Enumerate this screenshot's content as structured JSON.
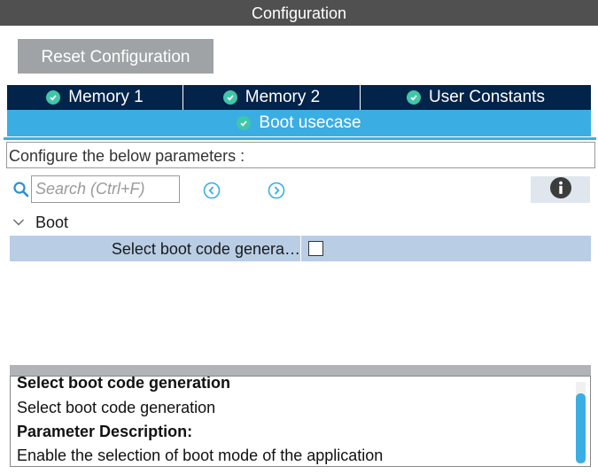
{
  "window": {
    "title": "Configuration"
  },
  "toolbar": {
    "reset_label": "Reset Configuration"
  },
  "tabs": [
    {
      "label": "Memory 1"
    },
    {
      "label": "Memory 2"
    },
    {
      "label": "User Constants"
    }
  ],
  "active_tab": {
    "label": "Boot usecase"
  },
  "params_header": "Configure the below parameters :",
  "search": {
    "placeholder": "Search (Ctrl+F)"
  },
  "tree": {
    "group_label": "Boot",
    "params": [
      {
        "name": "Select boot code genera…",
        "checked": false
      }
    ]
  },
  "description": {
    "cut_title": "Select boot code generation",
    "subtitle": "Select boot code generation",
    "heading": "Parameter Description:",
    "text": "Enable the selection of boot mode of the application"
  },
  "colors": {
    "title_bar": "#505050",
    "tab_bg": "#02234a",
    "active_tab_bg": "#3aaee3",
    "check_green": "#40c6a8",
    "row_highlight": "#b9cde5"
  },
  "icons": {
    "tab_status": "check-circle-icon",
    "search": "search-icon",
    "prev": "chevron-left-circle-icon",
    "next": "chevron-right-circle-icon",
    "info": "info-icon",
    "expand": "chevron-down-icon"
  }
}
